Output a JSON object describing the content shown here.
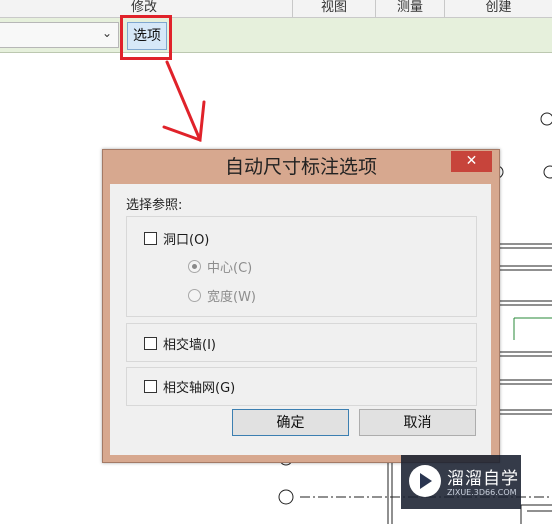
{
  "ribbon": {
    "tabs": [
      "修改",
      "视图",
      "测量",
      "创建"
    ],
    "options_button": "选项"
  },
  "dialog": {
    "title": "自动尺寸标注选项",
    "close_glyph": "✕",
    "select_references_label": "选择参照:",
    "openings": {
      "label": "洞口(O)",
      "checked": false
    },
    "center": {
      "label": "中心(C)",
      "selected": true,
      "enabled": false
    },
    "width": {
      "label": "宽度(W)",
      "selected": false,
      "enabled": false
    },
    "intersecting_walls": {
      "label": "相交墙(I)",
      "checked": false
    },
    "intersecting_grids": {
      "label": "相交轴网(G)",
      "checked": false
    },
    "ok_button": "确定",
    "cancel_button": "取消"
  },
  "watermark": {
    "brand": "溜溜自学",
    "url": "ZIXUE.3D66.COM"
  },
  "colors": {
    "highlight_box": "#e0222a",
    "arrow": "#e0222a",
    "dialog_frame": "#d7a88f",
    "close_button": "#c7443b"
  }
}
